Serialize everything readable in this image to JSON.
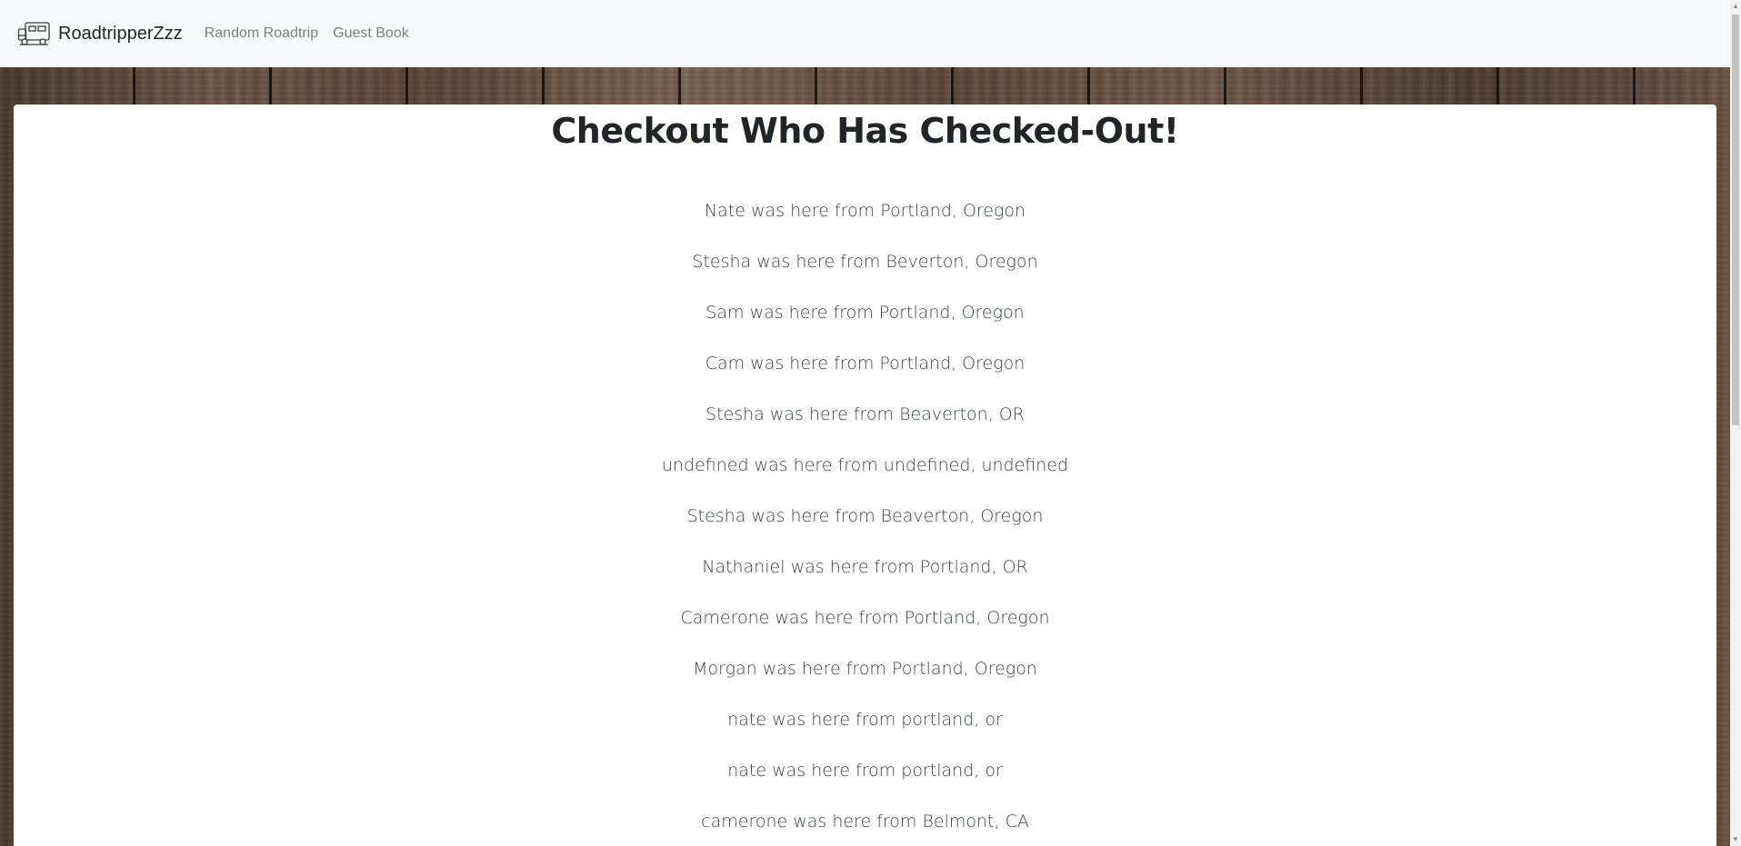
{
  "navbar": {
    "brand_label": "RoadtripperZzz",
    "brand_icon": "rv-camper-icon",
    "links": [
      {
        "label": "Random Roadtrip"
      },
      {
        "label": "Guest Book"
      }
    ]
  },
  "main": {
    "title": "Checkout Who Has Checked-Out!",
    "entries": [
      "Nate was here from Portland, Oregon",
      "Stesha was here from Beverton, Oregon",
      "Sam was here from Portland, Oregon",
      "Cam was here from Portland, Oregon",
      "Stesha was here from Beaverton, OR",
      "undefined was here from undefined, undefined",
      "Stesha was here from Beaverton, Oregon",
      "Nathaniel was here from Portland, OR",
      "Camerone was here from Portland, Oregon",
      "Morgan was here from Portland, Oregon",
      "nate was here from portland, or",
      "nate was here from portland, or",
      "camerone was here from Belmont, CA"
    ]
  },
  "colors": {
    "navbar_bg": "#f8f9fa",
    "text_dark": "#212529",
    "nav_link": "#7b7f84",
    "card_bg": "#ffffff"
  }
}
